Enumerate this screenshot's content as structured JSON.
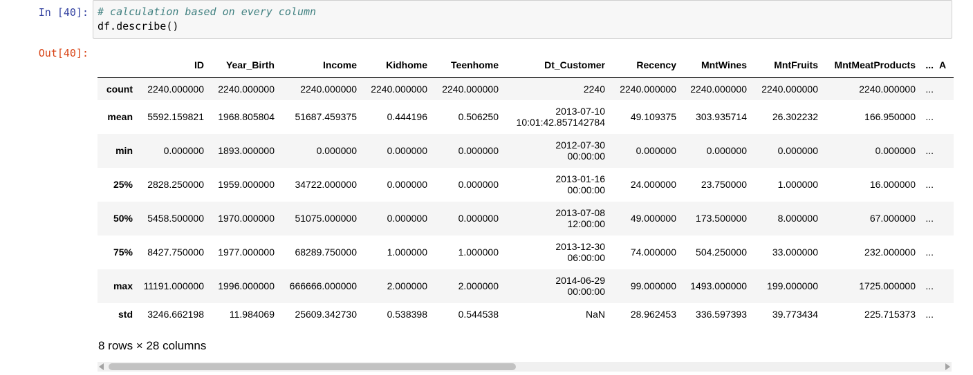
{
  "cell": {
    "in_prompt": "In [40]:",
    "out_prompt": "Out[40]:",
    "code": [
      "# calculation based on every column",
      "df.describe()"
    ]
  },
  "table": {
    "index_header": "",
    "columns": [
      "ID",
      "Year_Birth",
      "Income",
      "Kidhome",
      "Teenhome",
      "Dt_Customer",
      "Recency",
      "MntWines",
      "MntFruits",
      "MntMeatProducts",
      "...",
      "A"
    ],
    "rows": [
      {
        "label": "count",
        "cells": [
          "2240.000000",
          "2240.000000",
          "2240.000000",
          "2240.000000",
          "2240.000000",
          [
            "2240"
          ],
          "2240.000000",
          "2240.000000",
          "2240.000000",
          "2240.000000",
          "...",
          ""
        ]
      },
      {
        "label": "mean",
        "cells": [
          "5592.159821",
          "1968.805804",
          "51687.459375",
          "0.444196",
          "0.506250",
          [
            "2013-07-10",
            "10:01:42.857142784"
          ],
          "49.109375",
          "303.935714",
          "26.302232",
          "166.950000",
          "...",
          ""
        ]
      },
      {
        "label": "min",
        "cells": [
          "0.000000",
          "1893.000000",
          "0.000000",
          "0.000000",
          "0.000000",
          [
            "2012-07-30",
            "00:00:00"
          ],
          "0.000000",
          "0.000000",
          "0.000000",
          "0.000000",
          "...",
          ""
        ]
      },
      {
        "label": "25%",
        "cells": [
          "2828.250000",
          "1959.000000",
          "34722.000000",
          "0.000000",
          "0.000000",
          [
            "2013-01-16",
            "00:00:00"
          ],
          "24.000000",
          "23.750000",
          "1.000000",
          "16.000000",
          "...",
          ""
        ]
      },
      {
        "label": "50%",
        "cells": [
          "5458.500000",
          "1970.000000",
          "51075.000000",
          "0.000000",
          "0.000000",
          [
            "2013-07-08",
            "12:00:00"
          ],
          "49.000000",
          "173.500000",
          "8.000000",
          "67.000000",
          "...",
          ""
        ]
      },
      {
        "label": "75%",
        "cells": [
          "8427.750000",
          "1977.000000",
          "68289.750000",
          "1.000000",
          "1.000000",
          [
            "2013-12-30",
            "06:00:00"
          ],
          "74.000000",
          "504.250000",
          "33.000000",
          "232.000000",
          "...",
          ""
        ]
      },
      {
        "label": "max",
        "cells": [
          "11191.000000",
          "1996.000000",
          "666666.000000",
          "2.000000",
          "2.000000",
          [
            "2014-06-29",
            "00:00:00"
          ],
          "99.000000",
          "1493.000000",
          "199.000000",
          "1725.000000",
          "...",
          ""
        ]
      },
      {
        "label": "std",
        "cells": [
          "3246.662198",
          "11.984069",
          "25609.342730",
          "0.538398",
          "0.544538",
          [
            "NaN"
          ],
          "28.962453",
          "336.597393",
          "39.773434",
          "225.715373",
          "...",
          ""
        ]
      }
    ]
  },
  "summary": "8 rows × 28 columns",
  "scrollbar": {
    "position_fraction": 0.0,
    "visible_fraction": 0.49
  }
}
